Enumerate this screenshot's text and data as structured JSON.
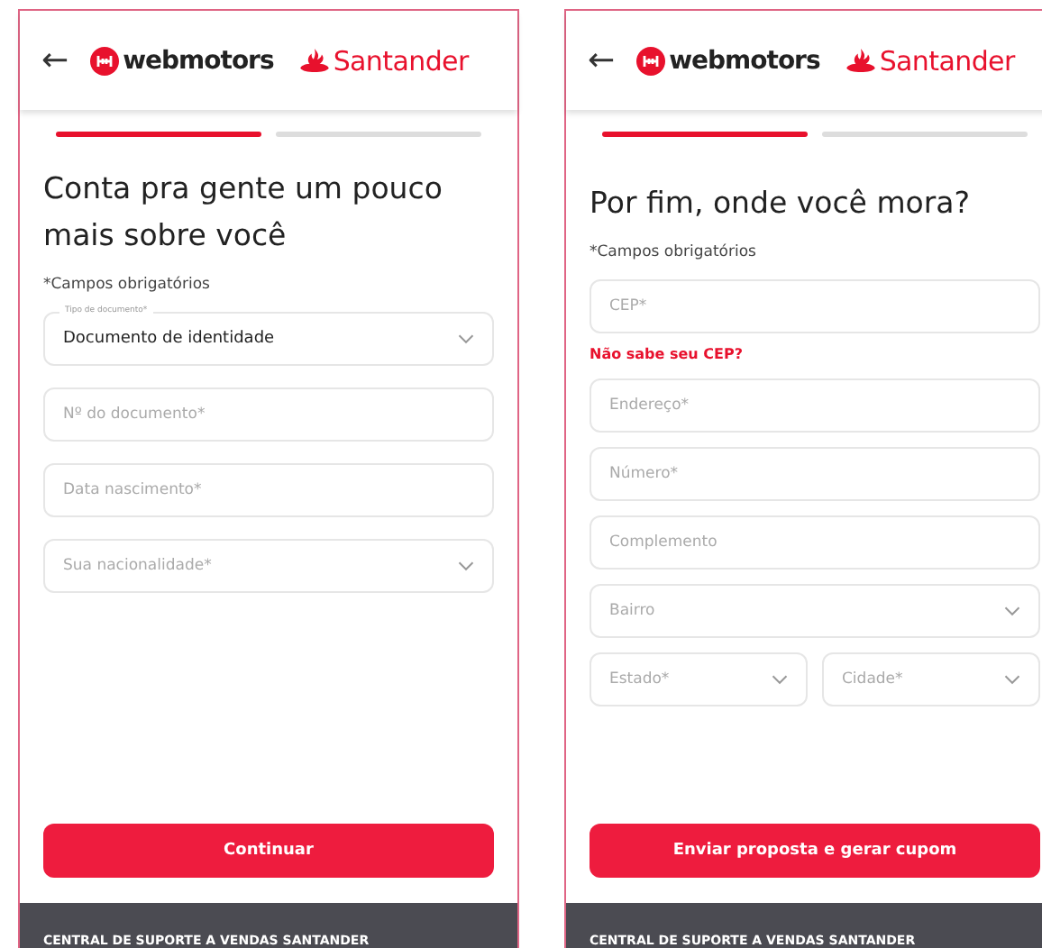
{
  "screens": [
    {
      "brand": {
        "webmotors": "webmotors",
        "santander": "Santander"
      },
      "back_icon": "←",
      "steps": [
        {
          "active": true
        },
        {
          "active": false
        }
      ],
      "title": "Conta pra gente um pouco mais sobre você",
      "required_note": "*Campos obrigatórios",
      "fields": [
        {
          "kind": "select",
          "label": "Tipo de documento*",
          "value": "Documento de identidade"
        },
        {
          "kind": "text",
          "placeholder": "Nº do documento*"
        },
        {
          "kind": "text",
          "placeholder": "Data nascimento*"
        },
        {
          "kind": "select",
          "placeholder": "Sua nacionalidade*"
        }
      ],
      "submit": "Continuar",
      "footer": "CENTRAL DE SUPORTE A VENDAS SANTANDER"
    },
    {
      "brand": {
        "webmotors": "webmotors",
        "santander": "Santander"
      },
      "back_icon": "←",
      "steps": [
        {
          "active": true
        },
        {
          "active": false
        }
      ],
      "title": "Por fim, onde você mora?",
      "required_note": "*Campos obrigatórios",
      "fields": [
        {
          "kind": "text",
          "placeholder": "CEP*"
        },
        {
          "kind": "link",
          "text": "Não sabe seu CEP?"
        },
        {
          "kind": "text",
          "placeholder": "Endereço*"
        },
        {
          "kind": "text",
          "placeholder": "Número*"
        },
        {
          "kind": "text",
          "placeholder": "Complemento"
        },
        {
          "kind": "select",
          "placeholder": "Bairro"
        },
        {
          "kind": "pair",
          "fields": [
            {
              "kind": "select",
              "placeholder": "Estado*"
            },
            {
              "kind": "select",
              "placeholder": "Cidade*"
            }
          ]
        }
      ],
      "submit": "Enviar proposta e gerar cupom",
      "footer": "CENTRAL DE SUPORTE A VENDAS SANTANDER"
    }
  ]
}
